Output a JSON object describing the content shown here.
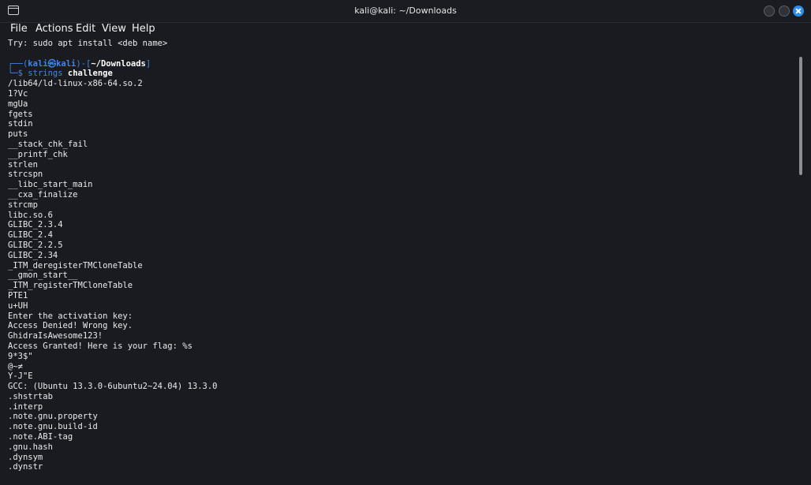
{
  "window": {
    "title": "kali@kali: ~/Downloads"
  },
  "menu": {
    "items": [
      {
        "label": "File"
      },
      {
        "label": "Actions"
      },
      {
        "label": "Edit"
      },
      {
        "label": "View"
      },
      {
        "label": "Help"
      }
    ]
  },
  "terminal": {
    "hint_line": "Try: sudo apt install <deb name>",
    "prompt": {
      "line1_start": "┌──(",
      "user": "kali㉿kali",
      "line1_mid": ")-[",
      "dir": "~/Downloads",
      "line1_end": "]",
      "line2_prefix": "└─$ ",
      "command": "strings",
      "argument": "challenge"
    },
    "output": [
      "/lib64/ld-linux-x86-64.so.2",
      "1?Vc",
      "mgUa",
      "fgets",
      "stdin",
      "puts",
      "__stack_chk_fail",
      "__printf_chk",
      "strlen",
      "strcspn",
      "__libc_start_main",
      "__cxa_finalize",
      "strcmp",
      "libc.so.6",
      "GLIBC_2.3.4",
      "GLIBC_2.4",
      "GLIBC_2.2.5",
      "GLIBC_2.34",
      "_ITM_deregisterTMCloneTable",
      "__gmon_start__",
      "_ITM_registerTMCloneTable",
      "PTE1",
      "u+UH",
      "Enter the activation key:",
      "Access Denied! Wrong key.",
      "GhidraIsAwesome123!",
      "Access Granted! Here is your flag: %s",
      "9*3$\"",
      "@~≠",
      "Y-J\"E",
      "GCC: (Ubuntu 13.3.0-6ubuntu2~24.04) 13.3.0",
      ".shstrtab",
      ".interp",
      ".note.gnu.property",
      ".note.gnu.build-id",
      ".note.ABI-tag",
      ".gnu.hash",
      ".dynsym",
      ".dynstr"
    ]
  },
  "colors": {
    "prompt_blue": "#3f86e8",
    "close_button": "#2f8cef",
    "background": "#191b20"
  }
}
